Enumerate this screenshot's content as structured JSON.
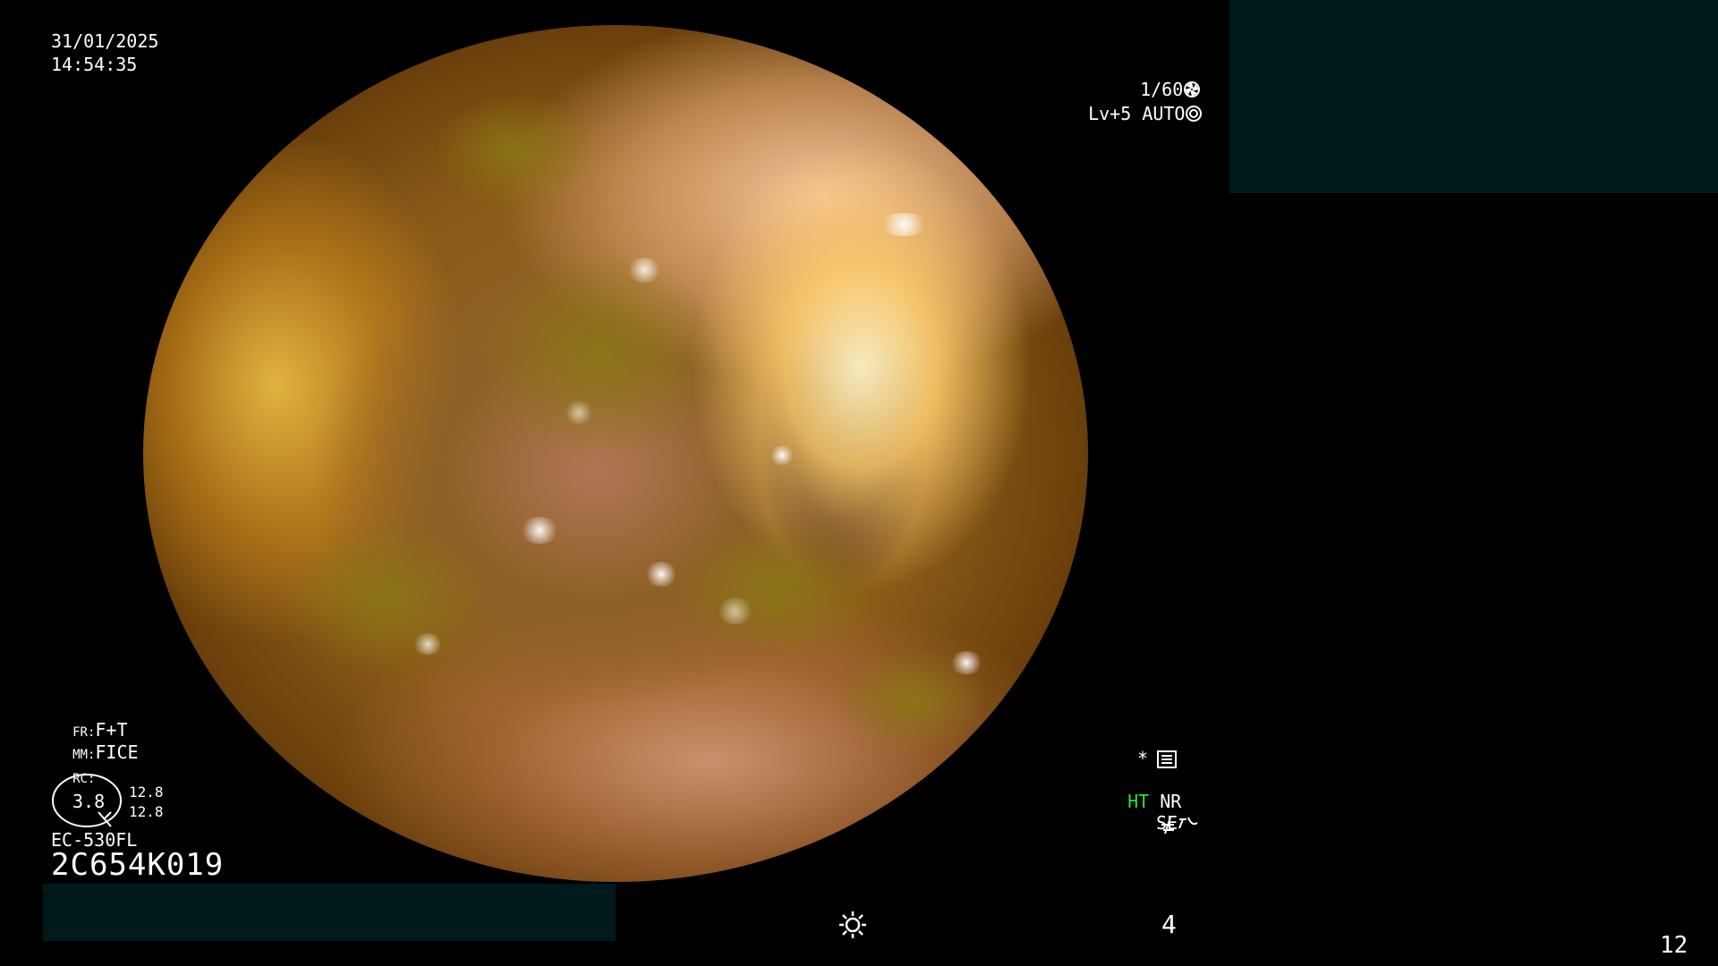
{
  "overlay": {
    "date": "31/01/2025",
    "time": "14:54:35",
    "shutter": "1/60",
    "level": "Lv+5",
    "auto": "AUTO",
    "fr_prefix": "FR:",
    "fr_value": "F+T",
    "mm_prefix": "MM:",
    "mm_value": "FICE",
    "rc_prefix": "RC:",
    "gauge_value": "3.8",
    "gauge_top": "12.8",
    "gauge_bottom": "12.8",
    "scope_model": "EC-530FL",
    "serial": "2C654K019",
    "star": "*",
    "ht": "HT",
    "nr": "NR",
    "se": "SE",
    "bottom_number": "4",
    "corner_number": "12"
  },
  "icons": {
    "shutter_icon": "aperture-icon",
    "auto_icon": "iris-icon",
    "menu_icon": "settings-panel-icon",
    "se_icon": "enhancement-curve-icon",
    "freeze_icon": "freeze-icon",
    "light_icon": "brightness-sun-icon"
  },
  "colors": {
    "ht_green": "#2ee02e",
    "redaction": "#00191a",
    "background": "#000000"
  }
}
